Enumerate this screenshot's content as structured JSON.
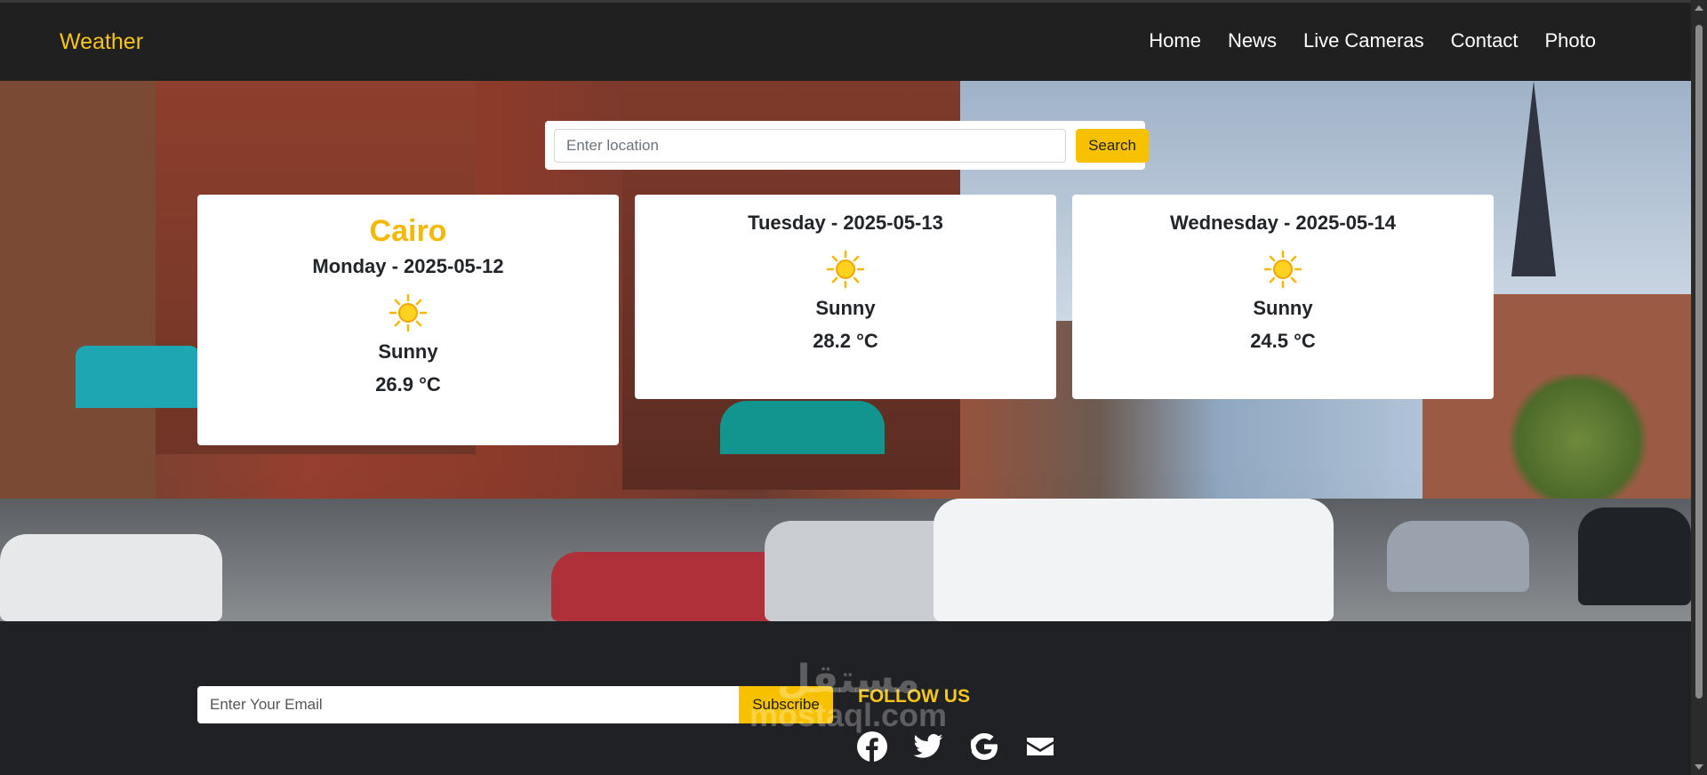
{
  "navbar": {
    "brand": "Weather",
    "links": [
      "Home",
      "News",
      "Live Cameras",
      "Contact",
      "Photo"
    ]
  },
  "search": {
    "placeholder": "Enter location",
    "button_label": "Search"
  },
  "forecast": [
    {
      "city": "Cairo",
      "day": "Monday - 2025-05-12",
      "condition": "Sunny",
      "temperature": "26.9 °C",
      "icon": "sun-icon"
    },
    {
      "day": "Tuesday - 2025-05-13",
      "condition": "Sunny",
      "temperature": "28.2 °C",
      "icon": "sun-icon"
    },
    {
      "day": "Wednesday - 2025-05-14",
      "condition": "Sunny",
      "temperature": "24.5 °C",
      "icon": "sun-icon"
    }
  ],
  "footer": {
    "email_placeholder": "Enter Your Email",
    "subscribe_label": "Subscribe",
    "follow_label": "FOLLOW US",
    "social_icons": [
      "facebook-icon",
      "twitter-icon",
      "google-icon",
      "email-icon"
    ],
    "watermark_arabic": "مستقل",
    "watermark_latin": "mostaql.com"
  },
  "colors": {
    "accent": "#f8c100",
    "navbar_bg": "#202020",
    "footer_bg": "#202124"
  }
}
